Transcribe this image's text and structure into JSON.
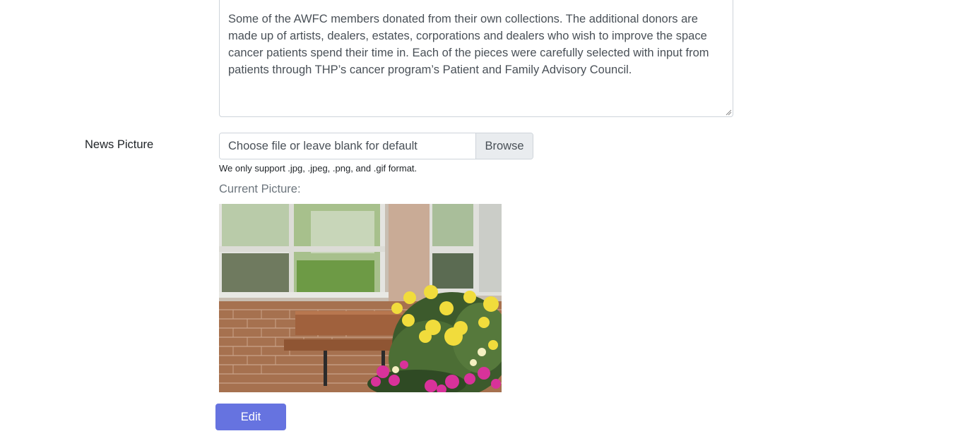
{
  "description": {
    "text": "Some of the AWFC members donated from their own collections. The additional donors are made up of artists, dealers, estates, corporations and dealers who wish to improve the space cancer patients spend their time in. Each of the pieces were carefully selected with input from patients through THP’s cancer program’s Patient and Family Advisory Council."
  },
  "news_picture": {
    "label": "News Picture",
    "file_placeholder": "Choose file or leave blank for default",
    "browse_label": "Browse",
    "help_text": "We only support .jpg, .jpeg, .png, and .gif format.",
    "current_label": "Current Picture:"
  },
  "actions": {
    "edit_label": "Edit"
  },
  "colors": {
    "primary_button": "#6673e0",
    "border": "#ced4da",
    "muted_text": "#6c757d"
  }
}
